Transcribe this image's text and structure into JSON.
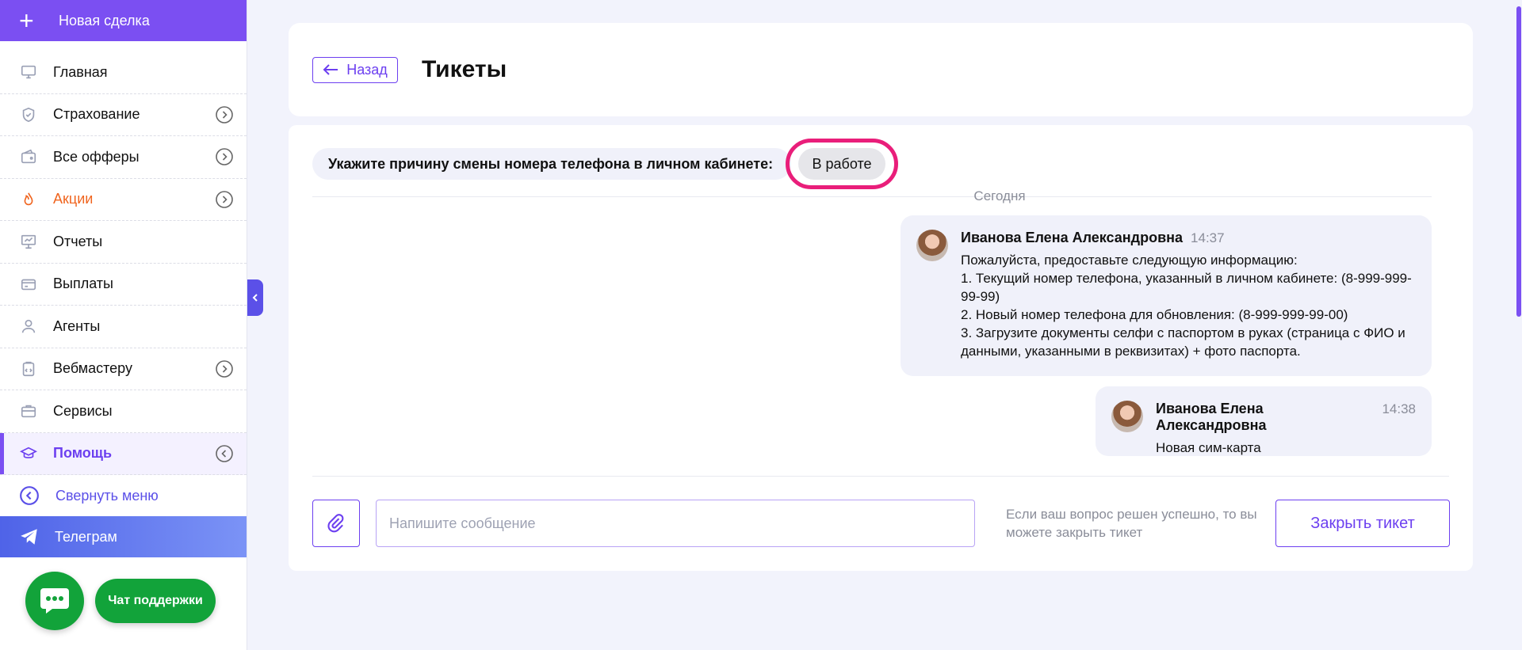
{
  "sidebar": {
    "new_deal": "Новая сделка",
    "items": [
      {
        "label": "Главная"
      },
      {
        "label": "Страхование"
      },
      {
        "label": "Все офферы"
      },
      {
        "label": "Акции"
      },
      {
        "label": "Отчеты"
      },
      {
        "label": "Выплаты"
      },
      {
        "label": "Агенты"
      },
      {
        "label": "Вебмастеру"
      },
      {
        "label": "Сервисы"
      },
      {
        "label": "Помощь"
      }
    ],
    "collapse": "Свернуть меню",
    "telegram": "Телеграм",
    "support_chat": "Чат поддержки",
    "accent_color": "#7b4ff2",
    "promo_color": "#f0641e"
  },
  "header": {
    "back": "Назад",
    "title": "Тикеты"
  },
  "ticket": {
    "subject": "Укажите причину смены номера телефона в личном кабинете:",
    "status": "В работе",
    "date_separator": "Сегодня",
    "messages": [
      {
        "author": "Иванова Елена Александровна",
        "time": "14:37",
        "text": "Пожалуйста, предоставьте следующую информацию:\n1. Текущий номер телефона, указанный в личном кабинете: (8-999-999-99-99)\n2. Новый номер телефона для обновления: (8-999-999-99-00)\n3. Загрузите документы селфи с паспортом в руках (страница с ФИО и данными, указанными в реквизитах) + фото паспорта."
      },
      {
        "author": "Иванова Елена Александровна",
        "time": "14:38",
        "text": "Новая сим-карта"
      }
    ],
    "input_placeholder": "Напишите сообщение",
    "close_hint": "Если ваш вопрос решен успешно, то вы можете закрыть тикет",
    "close_button": "Закрыть тикет",
    "status_highlight_color": "#e91e7a"
  }
}
